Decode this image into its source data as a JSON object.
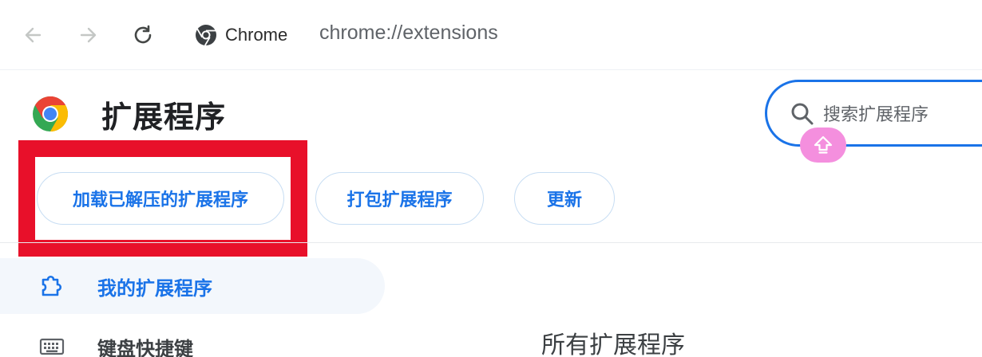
{
  "browser": {
    "site_chip_label": "Chrome",
    "url": "chrome://extensions"
  },
  "header": {
    "title": "扩展程序",
    "search_placeholder": "搜索扩展程序"
  },
  "actions": {
    "load_unpacked": "加载已解压的扩展程序",
    "pack": "打包扩展程序",
    "update": "更新"
  },
  "sidebar": {
    "items": [
      {
        "label": "我的扩展程序",
        "icon": "puzzle-icon",
        "active": true
      },
      {
        "label": "键盘快捷键",
        "icon": "keyboard-icon",
        "active": false
      }
    ]
  },
  "main": {
    "section_title": "所有扩展程序"
  },
  "colors": {
    "accent": "#1a73e8",
    "highlight": "#e8102a",
    "ime_badge": "#f48fde"
  }
}
